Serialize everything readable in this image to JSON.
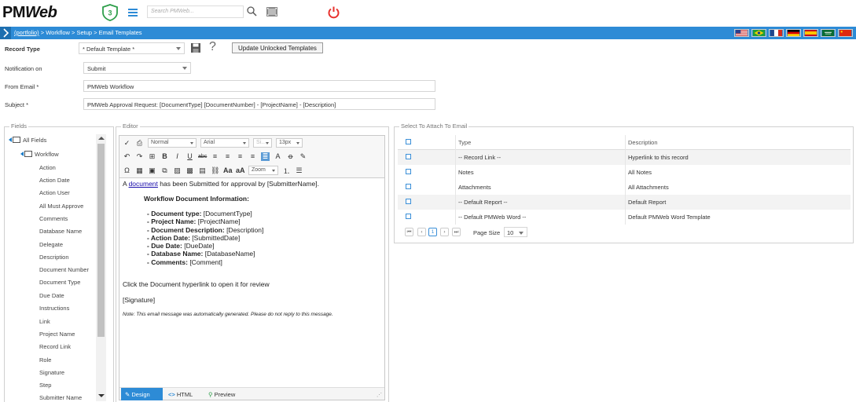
{
  "app": {
    "logo_text_a": "PM",
    "logo_text_b": "Web",
    "badge_count": "3",
    "search_placeholder": "Search PMWeb...",
    "colors": {
      "accent": "#2d8bd6",
      "power": "#e8302c",
      "badge": "#2e9e4a"
    }
  },
  "breadcrumb": {
    "root": "(portfolio)",
    "rest": " > Workflow > Setup > Email Templates"
  },
  "form": {
    "record_type_label": "Record Type",
    "record_type_value": "* Default Template *",
    "update_button": "Update Unlocked Templates",
    "notification_label": "Notification on",
    "notification_value": "Submit",
    "from_email_label": "From Email *",
    "from_email_value": "PMWeb Workflow",
    "subject_label": "Subject *",
    "subject_value": "PMWeb Approval Request: [DocumentType] [DocumentNumber] - [ProjectName] - [Description]"
  },
  "fields_panel": {
    "title": "Fields",
    "root": "All Fields",
    "group": "Workflow",
    "items": [
      "Action",
      "Action Date",
      "Action User",
      "All Must Approve",
      "Comments",
      "Database Name",
      "Delegate",
      "Description",
      "Document Number",
      "Document Type",
      "Due Date",
      "Instructions",
      "Link",
      "Project Name",
      "Record Link",
      "Role",
      "Signature",
      "Step",
      "Submitter Name"
    ]
  },
  "editor": {
    "title": "Editor",
    "format_select": "Normal",
    "font_select": "Arial",
    "size_select": "Si...",
    "px_select": "13px",
    "zoom_label": "Zoom",
    "line1_pre": "A ",
    "line1_link": "document",
    "line1_post": " has been Submitted for approval by [SubmitterName].",
    "heading": "Workflow Document Information:",
    "items": [
      {
        "label": "- Document type:",
        "value": " [DocumentType]"
      },
      {
        "label": "- Project Name:",
        "value": " [ProjectName]"
      },
      {
        "label": "- Document Description:",
        "value": " [Description]"
      },
      {
        "label": "- Action Date:",
        "value": " [SubmittedDate]"
      },
      {
        "label": "- Due Date:",
        "value": " [DueDate]"
      },
      {
        "label": "- Database Name:",
        "value": " [DatabaseName]"
      },
      {
        "label": "- Comments:",
        "value": " [Comment]"
      }
    ],
    "click_line": "Click the Document hyperlink to open it for review",
    "signature": "[Signature]",
    "note": "Note: This email message was automatically generated. Please do not reply to this message.",
    "modes": {
      "design": "Design",
      "html": "HTML",
      "preview": "Preview"
    }
  },
  "attach_panel": {
    "title": "Select To Attach To Email",
    "columns": {
      "type": "Type",
      "description": "Description"
    },
    "rows": [
      {
        "type": "-- Record Link --",
        "description": "Hyperlink to this record"
      },
      {
        "type": "Notes",
        "description": "All Notes"
      },
      {
        "type": "Attachments",
        "description": "All Attachments"
      },
      {
        "type": "-- Default Report --",
        "description": "Default Report"
      },
      {
        "type": "-- Default PMWeb Word --",
        "description": "Default PMWeb Word Template"
      }
    ],
    "pager": {
      "current_page": "1",
      "page_size_label": "Page Size",
      "page_size_value": "10"
    }
  }
}
